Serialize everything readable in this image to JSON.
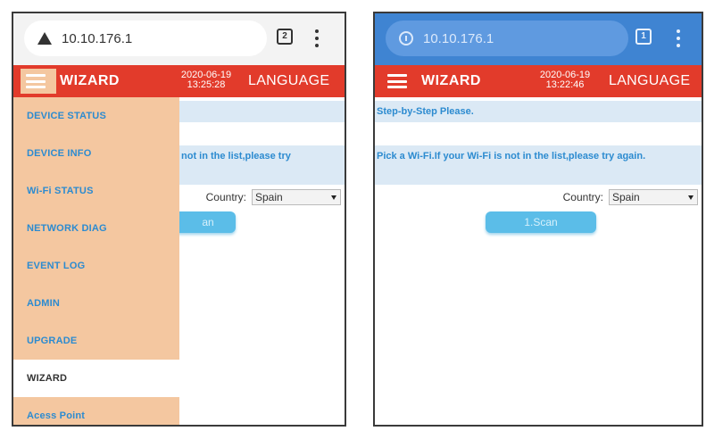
{
  "left_phone": {
    "url": "10.10.176.1",
    "tabs_count": "2",
    "url_icon": "warning-triangle-icon",
    "header": {
      "title": "WIZARD",
      "date": "2020-06-19",
      "time": "13:25:28",
      "language": "LANGUAGE"
    },
    "content": {
      "pick_text": "not in the list,please try",
      "country_label": "Country:",
      "country_value": "Spain",
      "scan_label": "an"
    },
    "drawer": {
      "items": [
        {
          "label": "DEVICE STATUS"
        },
        {
          "label": "DEVICE INFO"
        },
        {
          "label": "Wi-Fi STATUS"
        },
        {
          "label": "NETWORK DIAG"
        },
        {
          "label": "EVENT LOG"
        },
        {
          "label": "ADMIN"
        },
        {
          "label": "UPGRADE"
        },
        {
          "label": "WIZARD"
        },
        {
          "label": "Acess Point"
        }
      ],
      "active_item": "WIZARD"
    }
  },
  "right_phone": {
    "url": "10.10.176.1",
    "tabs_count": "1",
    "url_icon": "info-circle-icon",
    "header": {
      "title": "WIZARD",
      "date": "2020-06-19",
      "time": "13:22:46",
      "language": "LANGUAGE"
    },
    "content": {
      "step_text": "Step-by-Step Please.",
      "pick_text": "Pick a Wi-Fi.If your Wi-Fi is not in the list,please try again.",
      "country_label": "Country:",
      "country_value": "Spain",
      "scan_label": "1.Scan"
    }
  },
  "colors": {
    "header_red": "#e23b2b",
    "drawer_peach": "#f4c7a0",
    "link_blue": "#2c8bd0",
    "band_blue": "#dbe9f5",
    "scan_button": "#5bbde8",
    "chrome_blue": "#3f84d2"
  }
}
